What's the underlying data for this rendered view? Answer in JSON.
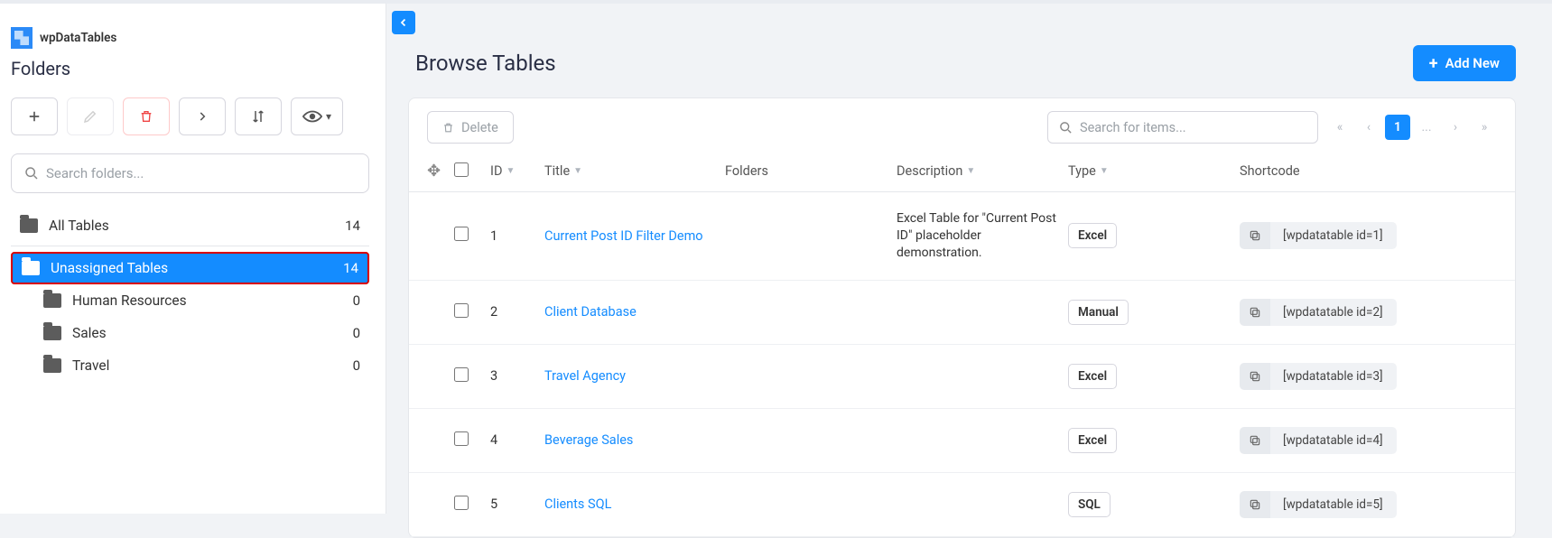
{
  "brand": {
    "name": "wpDataTables"
  },
  "sidebar": {
    "title": "Folders",
    "search_placeholder": "Search folders...",
    "all_label": "All Tables",
    "all_count": "14",
    "unassigned_label": "Unassigned Tables",
    "unassigned_count": "14",
    "subfolders": [
      {
        "label": "Human Resources",
        "count": "0"
      },
      {
        "label": "Sales",
        "count": "0"
      },
      {
        "label": "Travel",
        "count": "0"
      }
    ]
  },
  "main": {
    "page_title": "Browse Tables",
    "add_new_label": "Add New",
    "delete_label": "Delete",
    "search_placeholder": "Search for items...",
    "page_current": "1",
    "page_ellipsis": "..."
  },
  "columns": {
    "id": "ID",
    "title": "Title",
    "folders": "Folders",
    "description": "Description",
    "type": "Type",
    "shortcode": "Shortcode"
  },
  "rows": [
    {
      "id": "1",
      "title": "Current Post ID Filter Demo",
      "folders": "",
      "description": "Excel Table for \"Current Post ID\" placeholder demonstration.",
      "type": "Excel",
      "shortcode": "[wpdatatable id=1]"
    },
    {
      "id": "2",
      "title": "Client Database",
      "folders": "",
      "description": "",
      "type": "Manual",
      "shortcode": "[wpdatatable id=2]"
    },
    {
      "id": "3",
      "title": "Travel Agency",
      "folders": "",
      "description": "",
      "type": "Excel",
      "shortcode": "[wpdatatable id=3]"
    },
    {
      "id": "4",
      "title": "Beverage Sales",
      "folders": "",
      "description": "",
      "type": "Excel",
      "shortcode": "[wpdatatable id=4]"
    },
    {
      "id": "5",
      "title": "Clients SQL",
      "folders": "",
      "description": "",
      "type": "SQL",
      "shortcode": "[wpdatatable id=5]"
    }
  ]
}
